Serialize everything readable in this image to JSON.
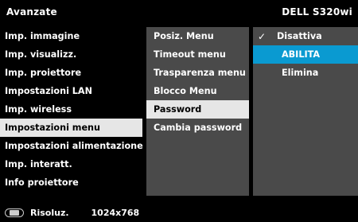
{
  "header": {
    "title": "Avanzate",
    "model": "DELL S320wi"
  },
  "menu_main": [
    {
      "label": "Imp. immagine"
    },
    {
      "label": "Imp. visualizz."
    },
    {
      "label": "Imp. proiettore"
    },
    {
      "label": "Impostazioni LAN"
    },
    {
      "label": "Imp. wireless"
    },
    {
      "label": "Impostazioni menu"
    },
    {
      "label": "Impostazioni alimentazione"
    },
    {
      "label": "Imp. interatt."
    },
    {
      "label": "Info proiettore"
    }
  ],
  "menu_sub": [
    {
      "label": "Posiz. Menu"
    },
    {
      "label": "Timeout menu"
    },
    {
      "label": "Trasparenza menu"
    },
    {
      "label": "Blocco Menu"
    },
    {
      "label": "Password"
    },
    {
      "label": "Cambia password"
    }
  ],
  "menu_options": [
    {
      "label": "Disattiva",
      "check": "✓"
    },
    {
      "label": "ABILITA"
    },
    {
      "label": "Elimina"
    }
  ],
  "status": {
    "label": "Risoluz.",
    "value": "1024x768",
    "icon": "monitor-icon"
  },
  "colors": {
    "highlight": "#0a9ad1",
    "selected": "#e6e6e6",
    "panel": "#4a4a4a"
  }
}
